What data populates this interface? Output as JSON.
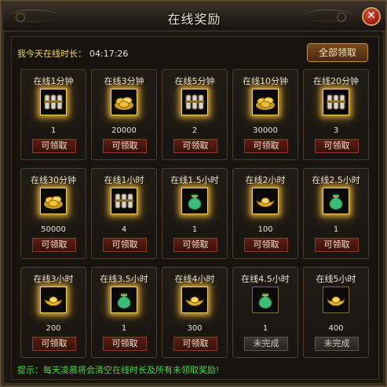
{
  "window": {
    "title": "在线奖励"
  },
  "online": {
    "label": "我今天在线时长：",
    "value": "04:17:26"
  },
  "claim_all_label": "全部领取",
  "tip": "提示：每天凌晨将会清空在线时长及所有未领取奖励!",
  "rewards": [
    {
      "label": "在线1分钟",
      "qty": "1",
      "status": "可领取",
      "icon": "scroll-bundle-icon"
    },
    {
      "label": "在线3分钟",
      "qty": "20000",
      "status": "可领取",
      "icon": "gold-coins-icon"
    },
    {
      "label": "在线5分钟",
      "qty": "2",
      "status": "可领取",
      "icon": "scroll-bundle-icon"
    },
    {
      "label": "在线10分钟",
      "qty": "30000",
      "status": "可领取",
      "icon": "gold-coins-icon"
    },
    {
      "label": "在线20分钟",
      "qty": "3",
      "status": "可领取",
      "icon": "scroll-bundle-icon"
    },
    {
      "label": "在线30分钟",
      "qty": "50000",
      "status": "可领取",
      "icon": "gold-coins-icon"
    },
    {
      "label": "在线1小时",
      "qty": "4",
      "status": "可领取",
      "icon": "scroll-bundle-icon"
    },
    {
      "label": "在线1.5小时",
      "qty": "1",
      "status": "可领取",
      "icon": "green-pouch-icon"
    },
    {
      "label": "在线2小时",
      "qty": "100",
      "status": "可领取",
      "icon": "gold-ingot-icon"
    },
    {
      "label": "在线2.5小时",
      "qty": "1",
      "status": "可领取",
      "icon": "green-pouch-icon"
    },
    {
      "label": "在线3小时",
      "qty": "200",
      "status": "可领取",
      "icon": "gold-ingot-icon"
    },
    {
      "label": "在线3.5小时",
      "qty": "1",
      "status": "可领取",
      "icon": "green-pouch-icon"
    },
    {
      "label": "在线4小时",
      "qty": "300",
      "status": "可领取",
      "icon": "gold-ingot-icon"
    },
    {
      "label": "在线4.5小时",
      "qty": "1",
      "status": "未完成",
      "icon": "green-pouch-icon"
    },
    {
      "label": "在线5小时",
      "qty": "400",
      "status": "未完成",
      "icon": "gold-ingot-icon"
    }
  ]
}
